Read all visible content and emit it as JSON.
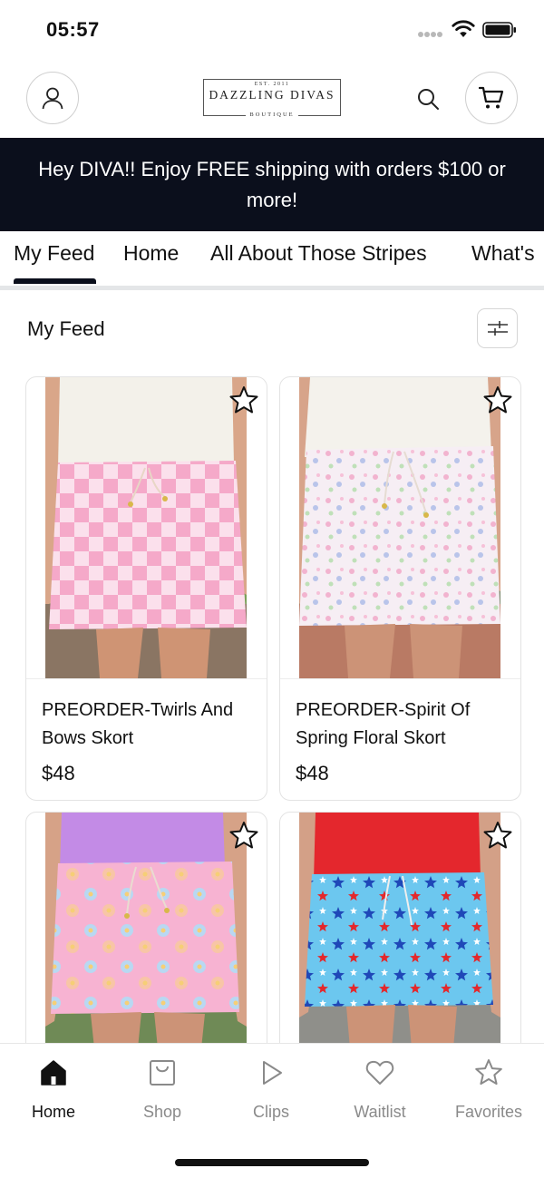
{
  "status_bar": {
    "time": "05:57",
    "icons": [
      "signal-icon",
      "wifi-icon",
      "battery-icon"
    ]
  },
  "header": {
    "logo": {
      "est": "EST. 2011",
      "name": "DAZZLING DIVAS",
      "sub": "BOUTIQUE"
    },
    "icons": [
      "account-icon",
      "search-icon",
      "cart-icon"
    ]
  },
  "promo": {
    "text": "Hey DIVA!! Enjoy FREE shipping with orders $100 or more!"
  },
  "nav": {
    "tabs": [
      {
        "label": "My Feed",
        "active": true
      },
      {
        "label": "Home"
      },
      {
        "label": "All About Those Stripes"
      },
      {
        "label": "What's"
      }
    ]
  },
  "feed": {
    "title": "My Feed",
    "filter_icon": "sliders-icon"
  },
  "products": [
    {
      "name": "PREORDER-Twirls And Bows Skort",
      "price": "$48",
      "image": "pink-checkered-skort"
    },
    {
      "name": "PREORDER-Spirit Of Spring Floral Skort",
      "price": "$48",
      "image": "white-floral-skort"
    },
    {
      "name": "",
      "price": "",
      "image": "pink-daisy-skort"
    },
    {
      "name": "",
      "price": "",
      "image": "blue-star-skort"
    }
  ],
  "bottom_nav": {
    "items": [
      {
        "label": "Home",
        "icon": "home-icon",
        "active": true
      },
      {
        "label": "Shop",
        "icon": "shopping-bag-icon"
      },
      {
        "label": "Clips",
        "icon": "play-icon"
      },
      {
        "label": "Waitlist",
        "icon": "heart-icon"
      },
      {
        "label": "Favorites",
        "icon": "star-icon"
      }
    ]
  },
  "colors": {
    "banner_bg": "#0b0f1c",
    "text": "#111111",
    "muted": "#8a8a8a",
    "divider": "#e4e6e8"
  }
}
